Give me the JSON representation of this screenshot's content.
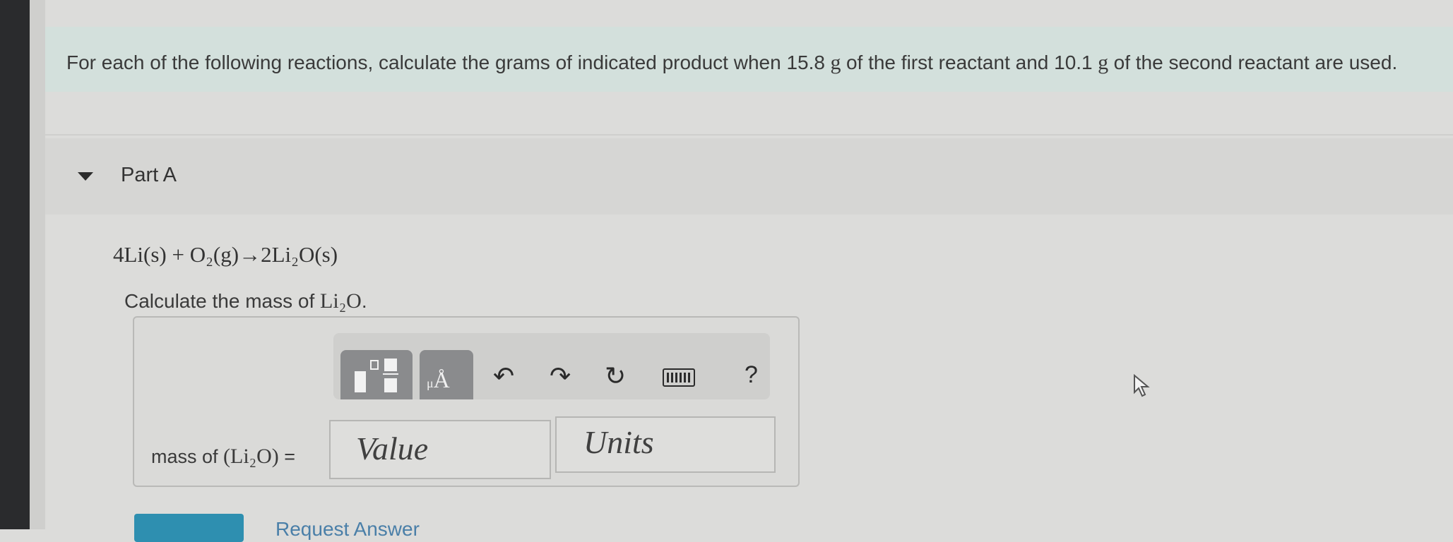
{
  "intro": {
    "text_a": "For each of the following reactions, calculate the grams of indicated product when 15.8",
    "unit_a": " g ",
    "text_b": "of the first reactant and 10.1",
    "unit_b": " g ",
    "text_c": "of the second reactant are used."
  },
  "part": {
    "title": "Part A"
  },
  "equation": "4Li(s) + O₂(g)→2Li₂O(s)",
  "prompt": {
    "text": "Calculate the mass of ",
    "formula": "Li₂O",
    "end": "."
  },
  "toolbar": {
    "templates_icon": "fraction-template-icon",
    "units_icon": "units-angstrom-icon",
    "units_glyph_small": "μ",
    "units_glyph": "Å",
    "undo_glyph": "↶",
    "redo_glyph": "↷",
    "reset_glyph": "↻",
    "keyboard_icon": "keyboard-icon",
    "help_label": "?"
  },
  "answer": {
    "label_text": "mass of ",
    "label_formula": "(Li₂O)",
    "label_eq": " =",
    "value_placeholder": "Value",
    "units_placeholder": "Units"
  },
  "actions": {
    "request_answer": "Request Answer"
  },
  "colors": {
    "accent": "#2e8fb0",
    "intro_bg": "#d3e0dc"
  }
}
